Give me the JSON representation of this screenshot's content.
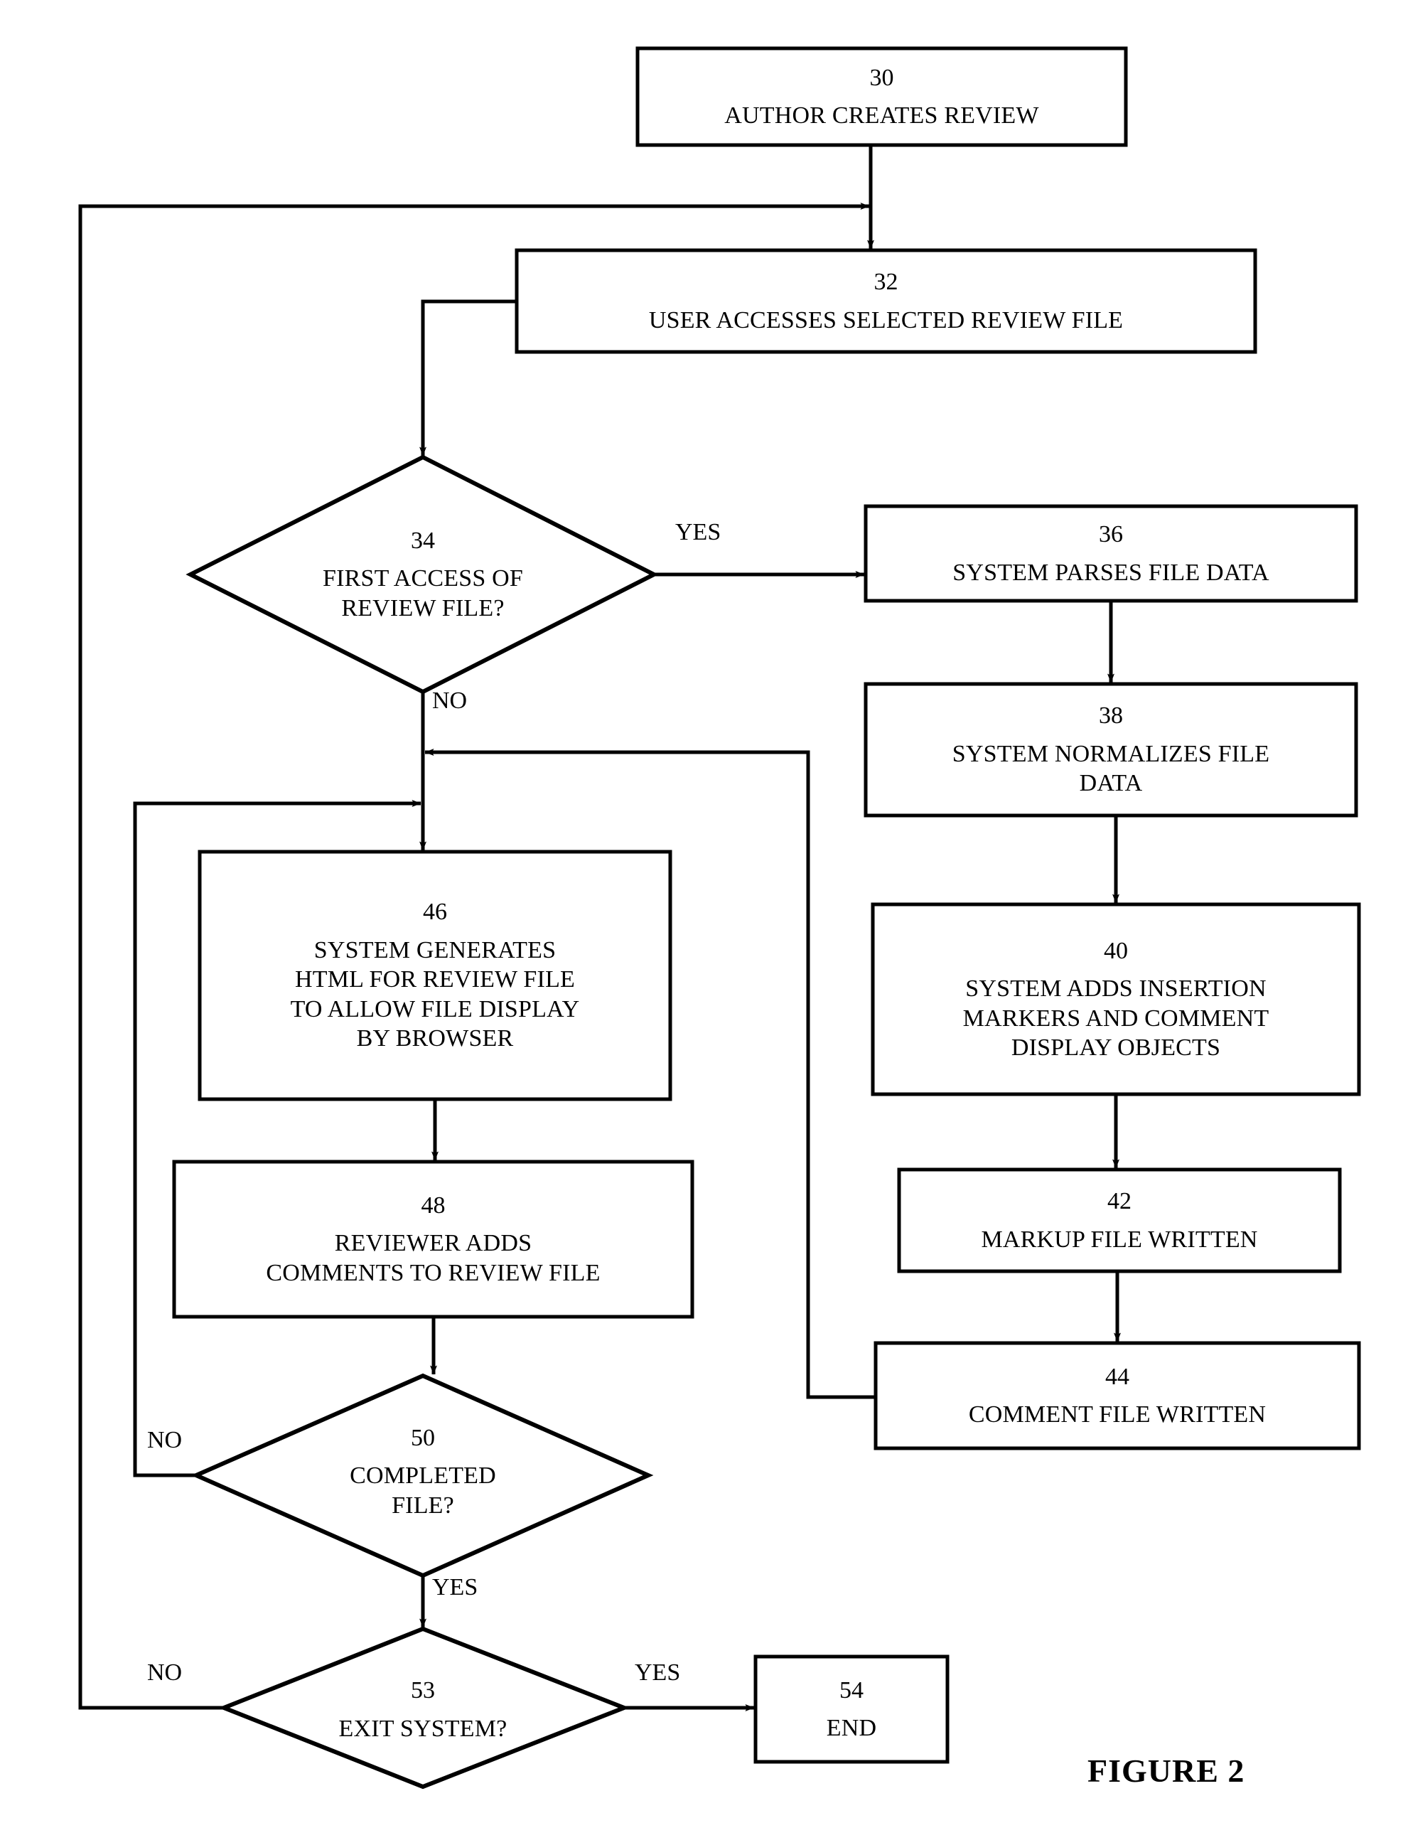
{
  "figure": {
    "caption": "FIGURE 2"
  },
  "chart_data": {
    "type": "diagram",
    "title": "FIGURE 2",
    "diagram_kind": "flowchart",
    "nodes": [
      {
        "id": "30",
        "shape": "process",
        "number": "30",
        "lines": [
          "AUTHOR CREATES REVIEW"
        ]
      },
      {
        "id": "32",
        "shape": "process",
        "number": "32",
        "lines": [
          "USER ACCESSES SELECTED REVIEW FILE"
        ]
      },
      {
        "id": "34",
        "shape": "decision",
        "number": "34",
        "lines": [
          "FIRST ACCESS OF",
          "REVIEW FILE?"
        ]
      },
      {
        "id": "36",
        "shape": "process",
        "number": "36",
        "lines": [
          "SYSTEM PARSES FILE DATA"
        ]
      },
      {
        "id": "38",
        "shape": "process",
        "number": "38",
        "lines": [
          "SYSTEM NORMALIZES FILE",
          "DATA"
        ]
      },
      {
        "id": "40",
        "shape": "process",
        "number": "40",
        "lines": [
          "SYSTEM ADDS INSERTION",
          "MARKERS AND COMMENT",
          "DISPLAY OBJECTS"
        ]
      },
      {
        "id": "42",
        "shape": "process",
        "number": "42",
        "lines": [
          "MARKUP FILE WRITTEN"
        ]
      },
      {
        "id": "44",
        "shape": "process",
        "number": "44",
        "lines": [
          "COMMENT FILE WRITTEN"
        ]
      },
      {
        "id": "46",
        "shape": "process",
        "number": "46",
        "lines": [
          "SYSTEM GENERATES",
          "HTML FOR REVIEW FILE",
          "TO ALLOW FILE DISPLAY",
          "BY BROWSER"
        ]
      },
      {
        "id": "48",
        "shape": "process",
        "number": "48",
        "lines": [
          "REVIEWER ADDS",
          "COMMENTS TO REVIEW FILE"
        ]
      },
      {
        "id": "50",
        "shape": "decision",
        "number": "50",
        "lines": [
          "COMPLETED",
          "FILE?"
        ]
      },
      {
        "id": "53",
        "shape": "decision",
        "number": "53",
        "lines": [
          "EXIT SYSTEM?"
        ]
      },
      {
        "id": "54",
        "shape": "terminal",
        "number": "54",
        "lines": [
          "END"
        ]
      }
    ],
    "edges": [
      {
        "from": "30",
        "to": "32",
        "label": ""
      },
      {
        "from": "32",
        "to": "34",
        "label": ""
      },
      {
        "from": "34",
        "to": "36",
        "label": "YES"
      },
      {
        "from": "34",
        "to": "46",
        "label": "NO"
      },
      {
        "from": "36",
        "to": "38",
        "label": ""
      },
      {
        "from": "38",
        "to": "40",
        "label": ""
      },
      {
        "from": "40",
        "to": "42",
        "label": ""
      },
      {
        "from": "42",
        "to": "44",
        "label": ""
      },
      {
        "from": "44",
        "to": "46",
        "label": ""
      },
      {
        "from": "46",
        "to": "48",
        "label": ""
      },
      {
        "from": "48",
        "to": "50",
        "label": ""
      },
      {
        "from": "50",
        "to": "46",
        "label": "NO"
      },
      {
        "from": "50",
        "to": "53",
        "label": "YES"
      },
      {
        "from": "53",
        "to": "54",
        "label": "YES"
      },
      {
        "from": "53",
        "to": "32",
        "label": "NO"
      }
    ]
  },
  "nodes": {
    "n30": {
      "number": "30",
      "l1": "AUTHOR CREATES REVIEW"
    },
    "n32": {
      "number": "32",
      "l1": "USER ACCESSES SELECTED REVIEW FILE"
    },
    "n34": {
      "number": "34",
      "l1": "FIRST ACCESS OF",
      "l2": "REVIEW FILE?"
    },
    "n36": {
      "number": "36",
      "l1": "SYSTEM PARSES FILE DATA"
    },
    "n38": {
      "number": "38",
      "l1": "SYSTEM NORMALIZES FILE",
      "l2": "DATA"
    },
    "n40": {
      "number": "40",
      "l1": "SYSTEM ADDS INSERTION",
      "l2": "MARKERS AND COMMENT",
      "l3": "DISPLAY OBJECTS"
    },
    "n42": {
      "number": "42",
      "l1": "MARKUP FILE WRITTEN"
    },
    "n44": {
      "number": "44",
      "l1": "COMMENT FILE WRITTEN"
    },
    "n46": {
      "number": "46",
      "l1": "SYSTEM GENERATES",
      "l2": "HTML FOR REVIEW FILE",
      "l3": "TO ALLOW FILE DISPLAY",
      "l4": "BY BROWSER"
    },
    "n48": {
      "number": "48",
      "l1": "REVIEWER ADDS",
      "l2": "COMMENTS TO REVIEW FILE"
    },
    "n50": {
      "number": "50",
      "l1": "COMPLETED",
      "l2": "FILE?"
    },
    "n53": {
      "number": "53",
      "l1": "EXIT SYSTEM?"
    },
    "n54": {
      "number": "54",
      "l1": "END"
    }
  },
  "edge_labels": {
    "yes_34": "YES",
    "no_34": "NO",
    "no_50": "NO",
    "yes_50": "YES",
    "no_53": "NO",
    "yes_53": "YES"
  },
  "colors": {
    "stroke": "#000000",
    "background": "#ffffff",
    "text": "#000000"
  }
}
